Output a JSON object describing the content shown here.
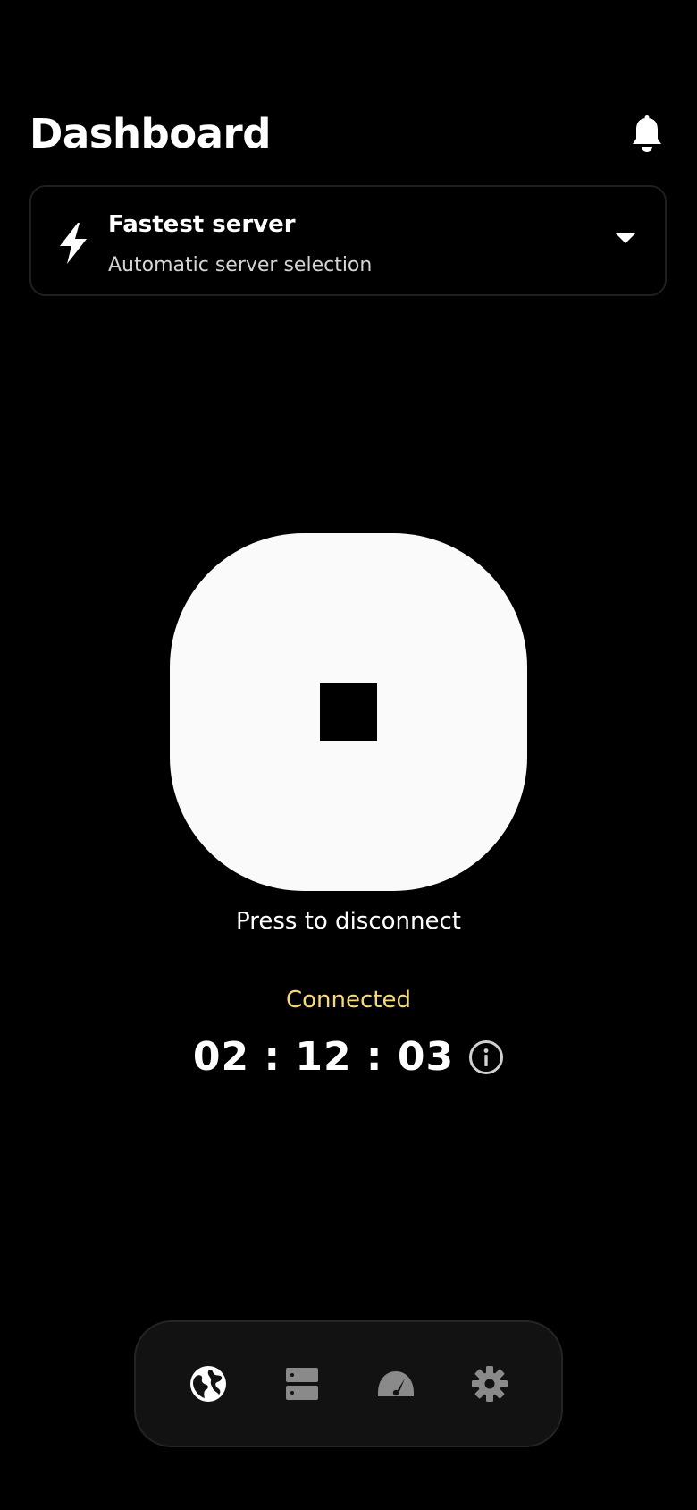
{
  "header": {
    "title": "Dashboard",
    "notification_icon": "bell-icon"
  },
  "server_selector": {
    "icon": "lightning-bolt-icon",
    "title": "Fastest server",
    "subtitle": "Automatic server selection",
    "dropdown_icon": "caret-down-icon"
  },
  "connection": {
    "button_icon": "stop-icon",
    "press_hint": "Press to disconnect",
    "status": "Connected",
    "duration": "02 : 12 : 03",
    "info_icon": "info-icon"
  },
  "nav": {
    "items": [
      {
        "name": "globe",
        "icon": "globe-icon",
        "active": true
      },
      {
        "name": "servers",
        "icon": "server-icon",
        "active": false
      },
      {
        "name": "speed",
        "icon": "speedometer-icon",
        "active": false
      },
      {
        "name": "settings",
        "icon": "gear-icon",
        "active": false
      }
    ]
  },
  "colors": {
    "background": "#000000",
    "status_connected": "#f5d97a",
    "button_surface": "#fafafa",
    "nav_surface": "#121212",
    "nav_inactive": "#8a8a8a",
    "nav_active": "#ffffff"
  }
}
